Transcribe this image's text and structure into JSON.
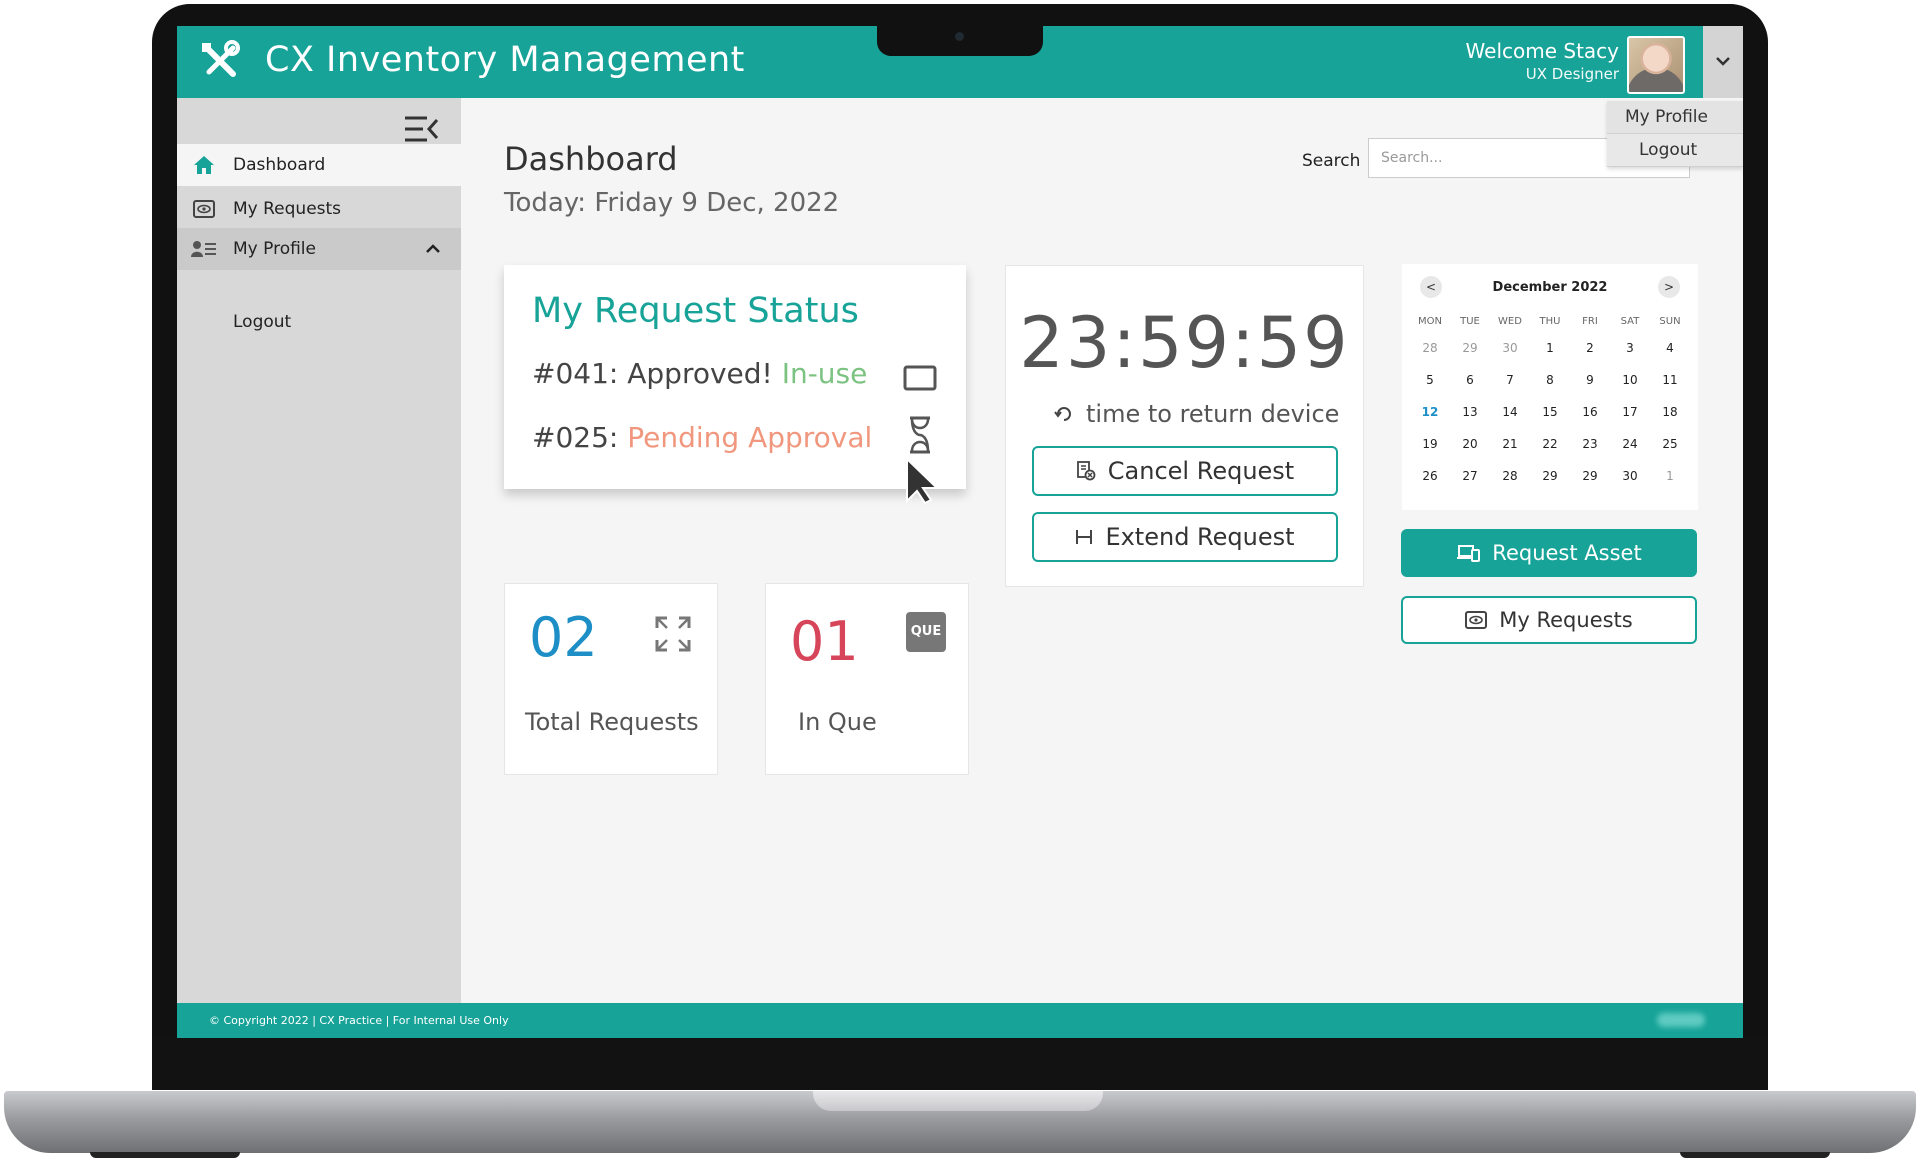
{
  "app": {
    "title": "CX Inventory Management",
    "welcome": "Welcome Stacy",
    "role": "UX Designer",
    "brand_color": "#17a398"
  },
  "user_menu": {
    "items": [
      "My Profile",
      "Logout"
    ]
  },
  "sidebar": {
    "items": [
      {
        "label": "Dashboard",
        "icon": "home-icon",
        "state": "active"
      },
      {
        "label": "My Requests",
        "icon": "eye-card-icon"
      },
      {
        "label": "My Profile",
        "icon": "profile-list-icon",
        "state": "expanded"
      }
    ],
    "sub_items": [
      "Logout"
    ]
  },
  "header": {
    "title": "Dashboard",
    "date": "Today: Friday 9 Dec, 2022"
  },
  "search": {
    "label": "Search",
    "placeholder": "Search..."
  },
  "request_status": {
    "title": "My Request Status",
    "rows": [
      {
        "id": "#041:",
        "status": "Approved!",
        "state": "In-use",
        "icon": "tablet-icon"
      },
      {
        "id": "#025:",
        "state": "Pending Approval",
        "icon": "hourglass-icon"
      }
    ]
  },
  "timer": {
    "value": "23:59:59",
    "note": "time to return device",
    "cancel_label": "Cancel Request",
    "extend_label": "Extend Request"
  },
  "stats": {
    "total": {
      "value": "02",
      "label": "Total Requests",
      "color": "#1d8fc6",
      "icon": "expand-icon"
    },
    "queue": {
      "value": "01",
      "label": "In Que",
      "color": "#d6455a",
      "icon": "que-badge-icon",
      "badge": "QUE"
    }
  },
  "calendar": {
    "month": "December 2022",
    "prev": "<",
    "next": ">",
    "weekdays": [
      "MON",
      "TUE",
      "WED",
      "THU",
      "FRI",
      "SAT",
      "SUN"
    ],
    "weeks": [
      [
        "28",
        "29",
        "30",
        "1",
        "2",
        "3",
        "4"
      ],
      [
        "5",
        "6",
        "7",
        "8",
        "9",
        "10",
        "11"
      ],
      [
        "12",
        "13",
        "14",
        "15",
        "16",
        "17",
        "18"
      ],
      [
        "19",
        "20",
        "21",
        "22",
        "23",
        "24",
        "25"
      ],
      [
        "26",
        "27",
        "28",
        "29",
        "29",
        "30",
        "1"
      ]
    ],
    "today": "12"
  },
  "actions": {
    "request_asset": "Request Asset",
    "my_requests": "My Requests"
  },
  "footer": {
    "text": "© Copyright 2022 | CX Practice | For Internal Use Only"
  }
}
